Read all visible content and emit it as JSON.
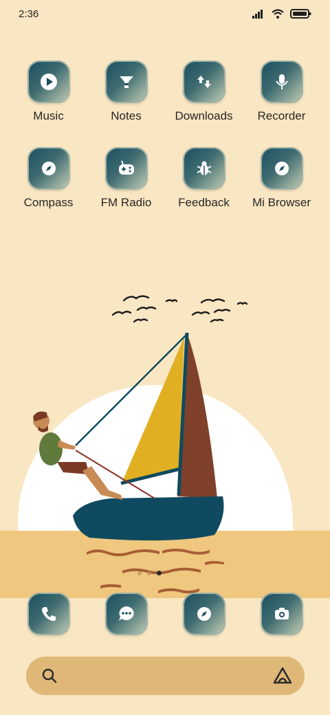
{
  "status": {
    "time": "2:36",
    "icons": [
      "signal-icon",
      "wifi-icon",
      "battery-icon"
    ]
  },
  "apps": [
    {
      "label": "Music",
      "icon": "play-icon"
    },
    {
      "label": "Notes",
      "icon": "notes-icon"
    },
    {
      "label": "Downloads",
      "icon": "download-icon"
    },
    {
      "label": "Recorder",
      "icon": "microphone-icon"
    },
    {
      "label": "Compass",
      "icon": "compass-icon"
    },
    {
      "label": "FM Radio",
      "icon": "radio-icon"
    },
    {
      "label": "Feedback",
      "icon": "bug-icon"
    },
    {
      "label": "Mi Browser",
      "icon": "browser-compass-icon"
    }
  ],
  "dock": [
    {
      "icon": "phone-icon"
    },
    {
      "icon": "message-icon"
    },
    {
      "icon": "browser-compass-icon"
    },
    {
      "icon": "camera-icon"
    }
  ],
  "search": {
    "placeholder": "",
    "left_icon": "search-icon",
    "right_icon": "assistant-icon"
  },
  "pager": {
    "count": 3,
    "active": 3
  },
  "colors": {
    "background": "#f9e6c2",
    "sand": "#efc77f",
    "sun": "#ffffff",
    "icon_dark": "#1b4e60",
    "sail_yellow": "#e1b022",
    "sail_brown": "#7f412a",
    "hull": "#0f4a60"
  }
}
